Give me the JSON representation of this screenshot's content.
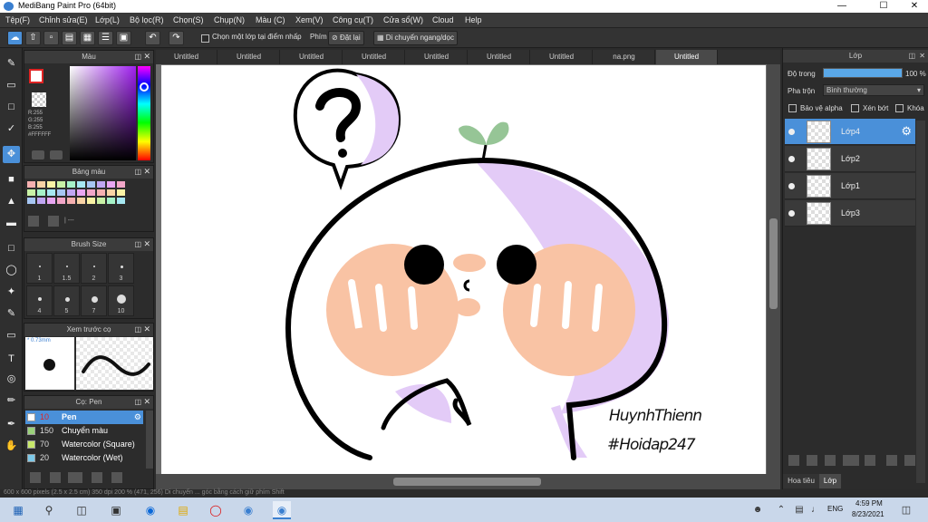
{
  "window": {
    "title": "MediBang Paint Pro (64bit)"
  },
  "menu": [
    "Tệp(F)",
    "Chỉnh sửa(E)",
    "Lớp(L)",
    "Bộ lọc(R)",
    "Chọn(S)",
    "Chụp(N)",
    "Màu (C)",
    "Xem(V)",
    "Công cụ(T)",
    "Cửa sổ(W)",
    "Cloud",
    "Help"
  ],
  "toolbar": {
    "select_layer_label": "Chọn một lớp tại điểm nhấp",
    "phim_label": "Phím",
    "reset_label": "Đặt lại",
    "move_label": "Di chuyển ngang/dọc"
  },
  "color_panel": {
    "title": "Màu",
    "r": "R:255",
    "g": "G:255",
    "b": "B:255",
    "hex": "#FFFFFF"
  },
  "palette_panel": {
    "title": "Bảng màu",
    "dash": "| ---"
  },
  "brush_size_panel": {
    "title": "Brush Size",
    "sizes": [
      "1",
      "1.5",
      "2",
      "3",
      "4",
      "5",
      "7",
      "10"
    ]
  },
  "preview_panel": {
    "title": "Xem trước cọ",
    "size": "0.73mm"
  },
  "brush_panel": {
    "title": "Cọ: Pen",
    "items": [
      {
        "size": "10",
        "name": "Pen",
        "color": "#ffffff"
      },
      {
        "size": "150",
        "name": "Chuyển màu",
        "color": "#9ad17a"
      },
      {
        "size": "70",
        "name": "Watercolor (Square)",
        "color": "#c8e86a"
      },
      {
        "size": "20",
        "name": "Watercolor (Wet)",
        "color": "#7cc9e8"
      }
    ]
  },
  "tabs": [
    "Untitled",
    "Untitled",
    "Untitled",
    "Untitled",
    "Untitled",
    "Untitled",
    "Untitled",
    "na.png",
    "Untitled"
  ],
  "artwork": {
    "signature_line1": "HuynhThienn",
    "signature_line2": "#Hoidap247"
  },
  "layer_panel": {
    "title": "Lớp",
    "opacity_label": "Độ trong",
    "opacity_value": "100 %",
    "opacity_fraction": 1.0,
    "blend_label": "Pha trộn",
    "blend_value": "Bình thường",
    "protect_alpha": "Bảo vệ alpha",
    "clip": "Xén bớt",
    "lock": "Khóa",
    "layers": [
      "Lớp4",
      "Lớp2",
      "Lớp1",
      "Lớp3"
    ],
    "bottom_tabs": [
      "Hoa tiêu",
      "Lớp"
    ]
  },
  "status": {
    "text": "600 x 600 pixels (2.5 x 2.5 cm)  350 dpi  200 %  (471, 256)   Di chuyển ... góc bằng cách giữ phím Shift"
  },
  "taskbar": {
    "time": "4:59 PM",
    "date": "8/23/2021",
    "lang": "ENG"
  },
  "colors": {
    "accent": "#4a90d9",
    "peach": "#f9c3a4",
    "lilac": "#e3cbf7",
    "leaf": "#96c596"
  }
}
